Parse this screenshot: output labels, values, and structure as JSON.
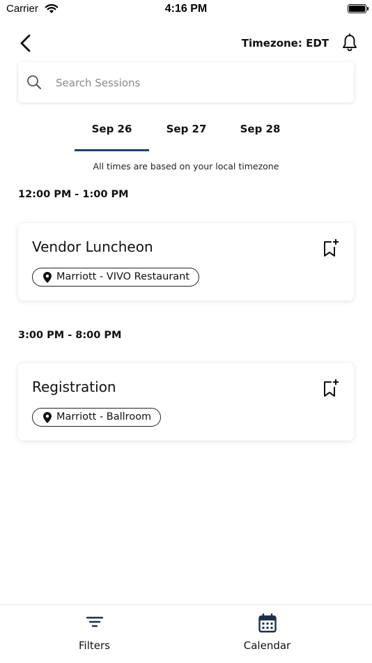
{
  "status_bar": {
    "carrier": "Carrier",
    "time": "4:16 PM"
  },
  "header": {
    "timezone": "Timezone: EDT"
  },
  "search": {
    "placeholder": "Search Sessions",
    "value": ""
  },
  "tabs": [
    {
      "label": "Sep 26",
      "active": true
    },
    {
      "label": "Sep 27",
      "active": false
    },
    {
      "label": "Sep 28",
      "active": false
    }
  ],
  "note": "All times are based on your local timezone",
  "groups": [
    {
      "time": "12:00 PM - 1:00 PM",
      "sessions": [
        {
          "title": "Vendor Luncheon",
          "location": "Marriott - VIVO Restaurant"
        }
      ]
    },
    {
      "time": "3:00 PM - 8:00 PM",
      "sessions": [
        {
          "title": "Registration",
          "location": "Marriott - Ballroom"
        }
      ]
    }
  ],
  "bottom_nav": [
    {
      "label": "Filters",
      "icon": "filter-icon"
    },
    {
      "label": "Calendar",
      "icon": "calendar-icon"
    }
  ],
  "colors": {
    "accent": "#1f3f6e",
    "text": "#111111",
    "placeholder": "#888888"
  }
}
